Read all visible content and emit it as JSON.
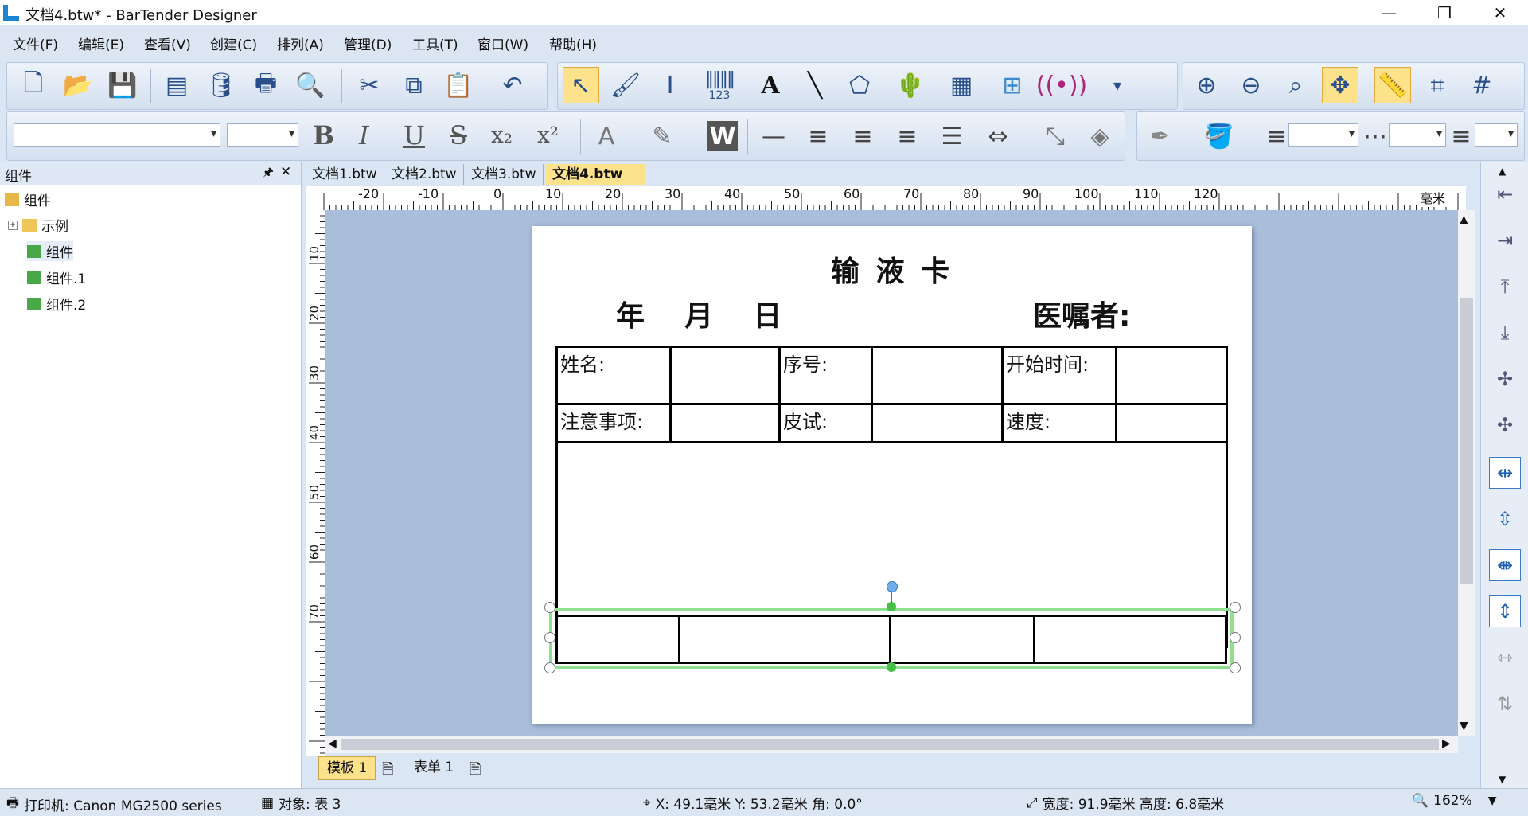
{
  "window": {
    "title": "文档4.btw* - BarTender Designer",
    "minimize": "—",
    "restore": "❐",
    "close": "✕"
  },
  "menu": [
    "文件(F)",
    "编辑(E)",
    "查看(V)",
    "创建(C)",
    "排列(A)",
    "管理(D)",
    "工具(T)",
    "窗口(W)",
    "帮助(H)"
  ],
  "toolbar": {
    "barcode_label": "123",
    "format": {
      "bold": "B",
      "italic": "I",
      "underline": "U",
      "strike": "S",
      "subscript": "x₂",
      "superscript": "x²"
    }
  },
  "left_panel": {
    "title": "组件",
    "pin": "🖈",
    "close": "✕",
    "tree": [
      {
        "label": "组件",
        "icon": "folder-open-icon"
      },
      {
        "label": "示例",
        "icon": "folder-icon"
      },
      {
        "label": "组件",
        "icon": "component-icon"
      },
      {
        "label": "组件.1",
        "icon": "component-icon"
      },
      {
        "label": "组件.2",
        "icon": "component-icon"
      }
    ]
  },
  "doc_tabs": [
    "文档1.btw",
    "文档2.btw",
    "文档3.btw",
    "文档4.btw"
  ],
  "doc_tab_close": "✕",
  "ruler": {
    "unit": "毫米",
    "h_ticks": [
      "-20",
      "-10",
      "0",
      "10",
      "20",
      "30",
      "40",
      "50",
      "60",
      "70",
      "80",
      "90",
      "100",
      "110",
      "120"
    ],
    "v_ticks": [
      "10",
      "20",
      "30",
      "40",
      "50",
      "60",
      "70"
    ]
  },
  "label": {
    "title": "输 液 卡",
    "date_line": "年    月    日",
    "doctor": "医嘱者:",
    "row1": [
      "姓名:",
      "序号:",
      "开始时间:"
    ],
    "row2": [
      "注意事项:",
      "皮试:",
      "速度:"
    ]
  },
  "page_tabs": [
    "模板 1",
    "表单 1"
  ],
  "status": {
    "printer": "打印机: Canon MG2500 series",
    "object": "对象: 表 3",
    "position": "X: 49.1毫米  Y: 53.2毫米  角: 0.0°",
    "size": "宽度: 91.9毫米  高度: 6.8毫米",
    "zoom": "162%"
  },
  "colors": {
    "selected": "#fde28c",
    "canvas": "#a9bedb",
    "selection_outline": "#7fd77f"
  }
}
